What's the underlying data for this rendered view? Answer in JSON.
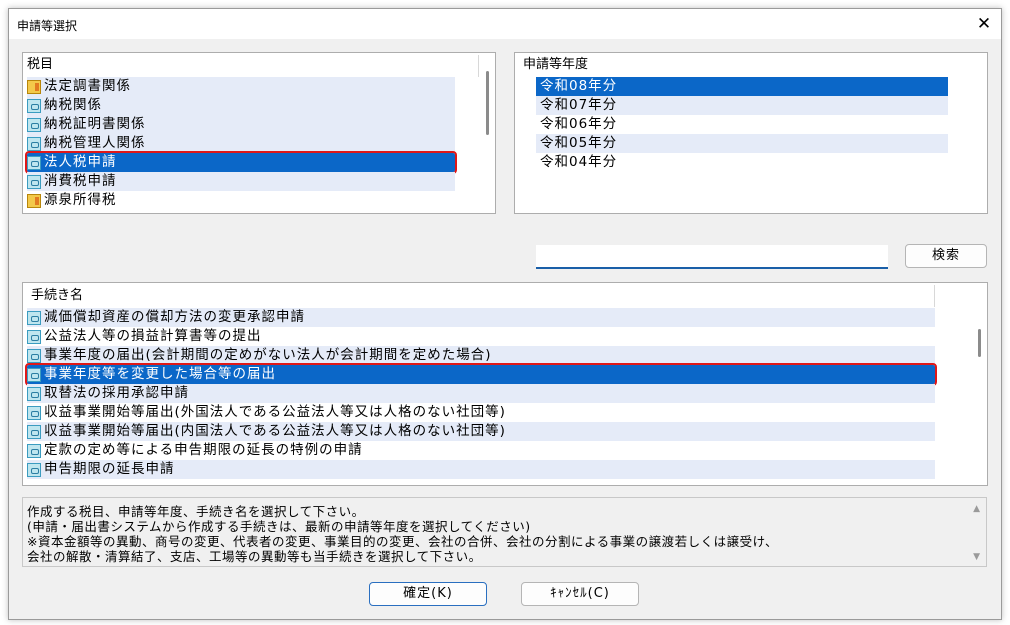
{
  "window": {
    "title": "申請等選択",
    "close_glyph": "✕"
  },
  "tax_items": {
    "header": "税目",
    "items": [
      {
        "label": "法定調書関係",
        "icon": "folder-icon",
        "state": "alt"
      },
      {
        "label": "納税関係",
        "icon": "doc-icon",
        "state": "alt"
      },
      {
        "label": "納税証明書関係",
        "icon": "doc-icon",
        "state": "alt"
      },
      {
        "label": "納税管理人関係",
        "icon": "doc-icon",
        "state": "alt"
      },
      {
        "label": "法人税申請",
        "icon": "doc-icon",
        "state": "selected"
      },
      {
        "label": "消費税申請",
        "icon": "doc-icon",
        "state": "alt"
      },
      {
        "label": "源泉所得税",
        "icon": "folder-icon",
        "state": "normal"
      }
    ]
  },
  "fiscal_years": {
    "header": "申請等年度",
    "items": [
      {
        "label": "令和08年分",
        "state": "selected"
      },
      {
        "label": "令和07年分",
        "state": "alt"
      },
      {
        "label": "令和06年分",
        "state": "normal"
      },
      {
        "label": "令和05年分",
        "state": "alt"
      },
      {
        "label": "令和04年分",
        "state": "normal"
      }
    ]
  },
  "search": {
    "value": "",
    "button_label": "検索"
  },
  "procedures": {
    "header": "手続き名",
    "items": [
      {
        "label": "減価償却資産の償却方法の変更承認申請",
        "state": "alt"
      },
      {
        "label": "公益法人等の損益計算書等の提出",
        "state": "normal"
      },
      {
        "label": "事業年度の届出(会計期間の定めがない法人が会計期間を定めた場合)",
        "state": "alt"
      },
      {
        "label": "事業年度等を変更した場合等の届出",
        "state": "selected"
      },
      {
        "label": "取替法の採用承認申請",
        "state": "alt"
      },
      {
        "label": "収益事業開始等届出(外国法人である公益法人等又は人格のない社団等)",
        "state": "normal"
      },
      {
        "label": "収益事業開始等届出(内国法人である公益法人等又は人格のない社団等)",
        "state": "alt"
      },
      {
        "label": "定款の定め等による申告期限の延長の特例の申請",
        "state": "normal"
      },
      {
        "label": "申告期限の延長申請",
        "state": "alt"
      }
    ]
  },
  "info": {
    "lines": [
      "作成する税目、申請等年度、手続き名を選択して下さい。",
      "(申請・届出書システムから作成する手続きは、最新の申請等年度を選択してください)",
      "※資本金額等の異動、商号の変更、代表者の変更、事業目的の変更、会社の合併、会社の分割による事業の譲渡若しくは譲受け、",
      "会社の解散・清算結了、支店、工場等の異動等も当手続きを選択して下さい。"
    ]
  },
  "buttons": {
    "ok": "確定(K)",
    "cancel": "ｷｬﾝｾﾙ(C)"
  }
}
